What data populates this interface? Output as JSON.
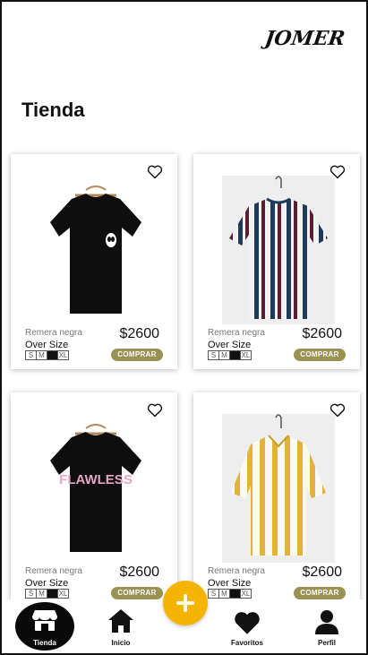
{
  "header": {
    "brand": "JOMER",
    "title": "Tienda"
  },
  "products": [
    {
      "name": "Remera negra",
      "price": "$2600",
      "size_label": "Over Size",
      "sizes": [
        "S",
        "M",
        "L",
        "XL"
      ],
      "selected_size": "L",
      "buy_label": "COMPRAR",
      "image": "black-alien-tshirt"
    },
    {
      "name": "Remera negra",
      "price": "$2600",
      "size_label": "Over Size",
      "sizes": [
        "S",
        "M",
        "L",
        "XL"
      ],
      "selected_size": "L",
      "buy_label": "COMPRAR",
      "image": "striped-navy-burgundy-tshirt"
    },
    {
      "name": "Remera negra",
      "price": "$2600",
      "size_label": "Over Size",
      "sizes": [
        "S",
        "M",
        "L",
        "XL"
      ],
      "selected_size": "L",
      "buy_label": "COMPRAR",
      "image": "black-flawless-tshirt",
      "image_text": "FLAWLESS"
    },
    {
      "name": "Remera negra",
      "price": "$2600",
      "size_label": "Over Size",
      "sizes": [
        "S",
        "M",
        "L",
        "XL"
      ],
      "selected_size": "L",
      "buy_label": "COMPRAR",
      "image": "yellow-striped-shirt"
    }
  ],
  "nav": {
    "items": [
      {
        "label": "Tienda",
        "icon": "store-icon",
        "active": true
      },
      {
        "label": "Inicio",
        "icon": "home-icon"
      },
      {
        "label": "Favoritos",
        "icon": "heart-icon"
      },
      {
        "label": "Perfil",
        "icon": "user-icon"
      }
    ],
    "fab_icon": "plus-icon"
  },
  "colors": {
    "buy_button": "#9a9253",
    "fab": "#f5b400",
    "text": "#111111"
  }
}
